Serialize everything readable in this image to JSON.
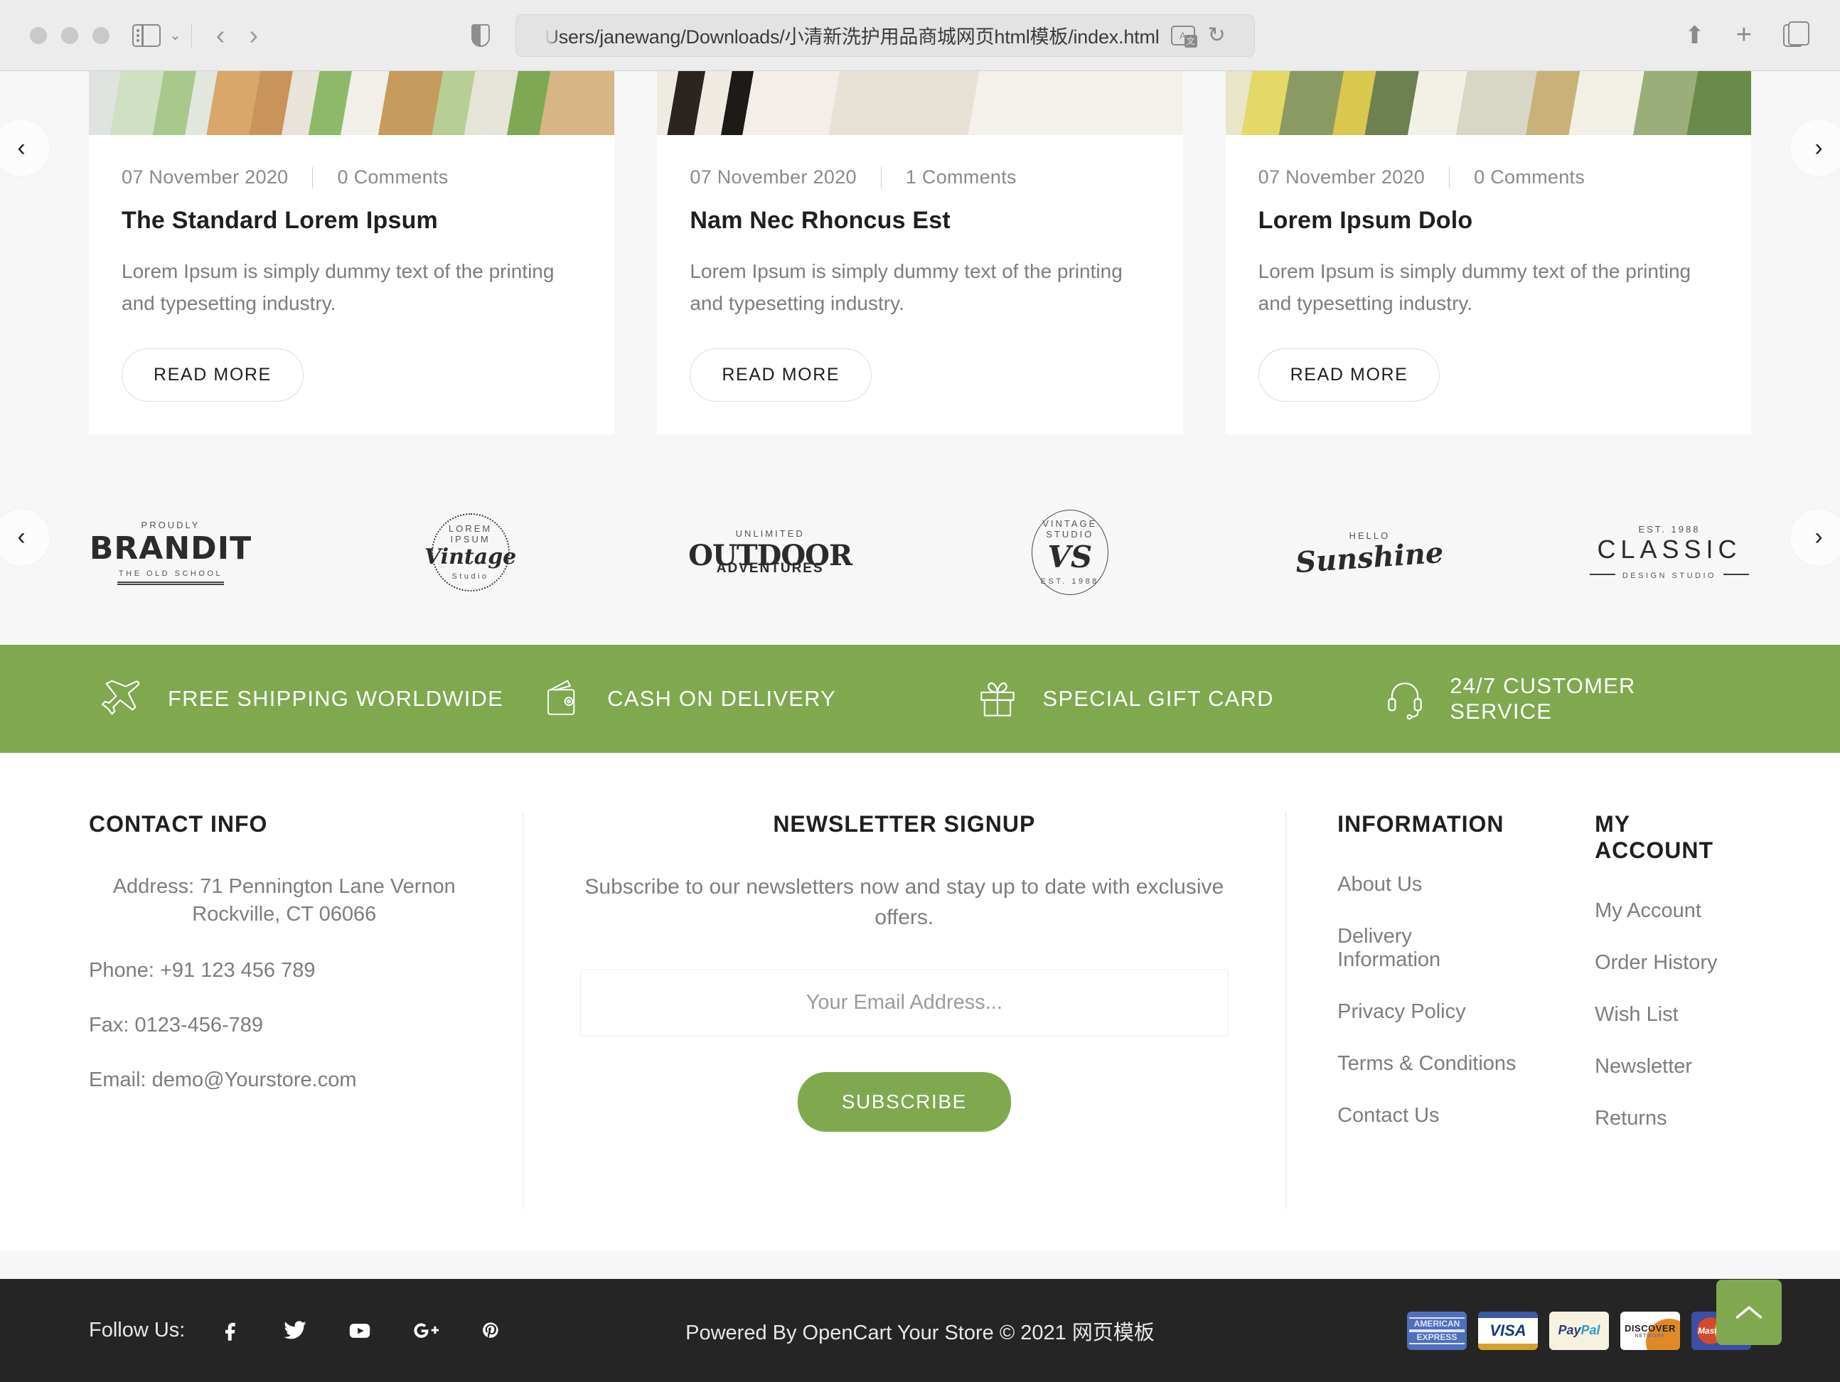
{
  "browser": {
    "url": "Users/janewang/Downloads/小清新洗护用品商城网页html模板/index.html",
    "sidebar_icon": "sidebar-icon",
    "back_icon": "chevron-left-icon",
    "forward_icon": "chevron-right-icon",
    "shield_icon": "shield-icon",
    "translate_icon": "translate-icon",
    "reload_icon": "reload-icon",
    "share_icon": "share-icon",
    "new_tab_icon": "plus-icon",
    "tabs_icon": "tab-overview-icon"
  },
  "blog": {
    "prev_label": "‹",
    "next_label": "›",
    "read_more_label": "READ MORE",
    "posts": [
      {
        "date": "07 November 2020",
        "comments": "0 Comments",
        "title": "The Standard Lorem Ipsum",
        "excerpt": "Lorem Ipsum is simply dummy text of the printing and typesetting industry.",
        "read_more": "READ MORE"
      },
      {
        "date": "07 November 2020",
        "comments": "1 Comments",
        "title": "Nam Nec Rhoncus Est",
        "excerpt": "Lorem Ipsum is simply dummy text of the printing and typesetting industry.",
        "read_more": "READ MORE"
      },
      {
        "date": "07 November 2020",
        "comments": "0 Comments",
        "title": "Lorem Ipsum Dolo",
        "excerpt": "Lorem Ipsum is simply dummy text of the printing and typesetting industry.",
        "read_more": "READ MORE"
      }
    ]
  },
  "brands": {
    "prev_label": "‹",
    "next_label": "›",
    "logos": [
      {
        "top": "Proudly",
        "main": "BRANDIT",
        "sub": "THE OLD SCHOOL"
      },
      {
        "top": "LOREM IPSUM",
        "main": "Vintage",
        "sub": "Studio"
      },
      {
        "top": "UNLIMITED",
        "main": "OUTDOOR",
        "sub": "ADVENTURES"
      },
      {
        "top": "VINTAGE STUDIO",
        "main": "VS",
        "sub": "EST. 1988"
      },
      {
        "top": "HELLO",
        "main": "Sunshine",
        "sub": ""
      },
      {
        "top": "EST. 1988",
        "main": "CLASSIC",
        "sub": "DESIGN STUDIO"
      }
    ]
  },
  "services": {
    "accent_color": "#7fa84f",
    "items": [
      {
        "icon": "airplane-icon",
        "label": "FREE SHIPPING WORLDWIDE"
      },
      {
        "icon": "wallet-icon",
        "label": "CASH ON DELIVERY"
      },
      {
        "icon": "gift-icon",
        "label": "SPECIAL GIFT CARD"
      },
      {
        "icon": "headset-icon",
        "label": "24/7 CUSTOMER SERVICE"
      }
    ]
  },
  "footer": {
    "contact": {
      "heading": "CONTACT INFO",
      "address_line1": "Address: 71 Pennington Lane Vernon",
      "address_line2": "Rockville, CT 06066",
      "phone": "Phone: +91 123 456 789",
      "fax": "Fax: 0123-456-789",
      "email": "Email: demo@Yourstore.com"
    },
    "newsletter": {
      "heading": "NEWSLETTER SIGNUP",
      "description": "Subscribe to our newsletters now and stay up to date with exclusive offers.",
      "email_placeholder": "Your Email Address...",
      "email_value": "",
      "subscribe_label": "SUBSCRIBE"
    },
    "information": {
      "heading": "INFORMATION",
      "links": [
        "About Us",
        "Delivery Information",
        "Privacy Policy",
        "Terms & Conditions",
        "Contact Us"
      ]
    },
    "my_account": {
      "heading": "MY ACCOUNT",
      "links": [
        "My Account",
        "Order History",
        "Wish List",
        "Newsletter",
        "Returns"
      ]
    }
  },
  "bottom": {
    "follow_label": "Follow Us:",
    "socials": [
      "facebook-icon",
      "twitter-icon",
      "youtube-icon",
      "google-plus-icon",
      "pinterest-icon"
    ],
    "copyright": "Powered By OpenCart Your Store © 2021 网页模板",
    "payments": [
      "AMERICAN EXPRESS",
      "VISA",
      "PayPal",
      "DISCOVER",
      "MasterCard"
    ],
    "scroll_top_icon": "chevron-up-icon"
  }
}
